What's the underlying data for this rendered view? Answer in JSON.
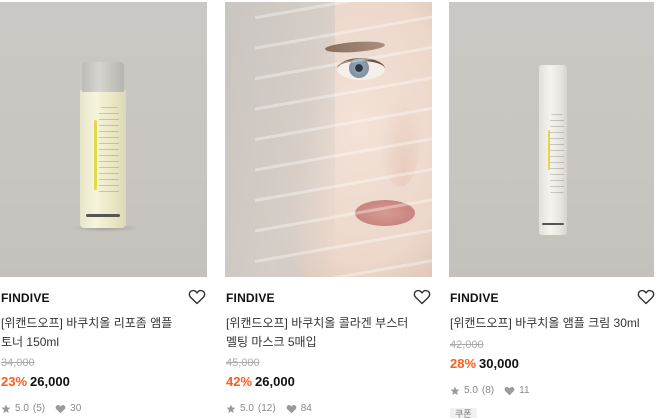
{
  "products": [
    {
      "brand": "FINDIVE",
      "title_line1": "[위캔드오프] 바쿠치올 리포좀 앰플",
      "title_line2": "토너 150ml",
      "original_price": "34,000",
      "discount": "23%",
      "price": "26,000",
      "rating": "5.0",
      "review_count": "(5)",
      "likes": "30",
      "image_icon": "toner-bottle-photo"
    },
    {
      "brand": "FINDIVE",
      "title_line1": "[위캔드오프] 바쿠치올 콜라겐 부스터",
      "title_line2": "멜팅 마스크 5매입",
      "original_price": "45,000",
      "discount": "42%",
      "price": "26,000",
      "rating": "5.0",
      "review_count": "(12)",
      "likes": "84",
      "image_icon": "face-mask-photo"
    },
    {
      "brand": "FINDIVE",
      "title_line1": "[위캔드오프] 바쿠치올 앰플 크림 30ml",
      "title_line2": "",
      "original_price": "42,000",
      "discount": "28%",
      "price": "30,000",
      "rating": "5.0",
      "review_count": "(8)",
      "likes": "11",
      "coupon": "쿠폰",
      "image_icon": "cream-bottle-photo"
    }
  ],
  "colors": {
    "discount": "#ff5b1a",
    "muted": "#8a8a8a",
    "strike": "#aaaaaa"
  }
}
